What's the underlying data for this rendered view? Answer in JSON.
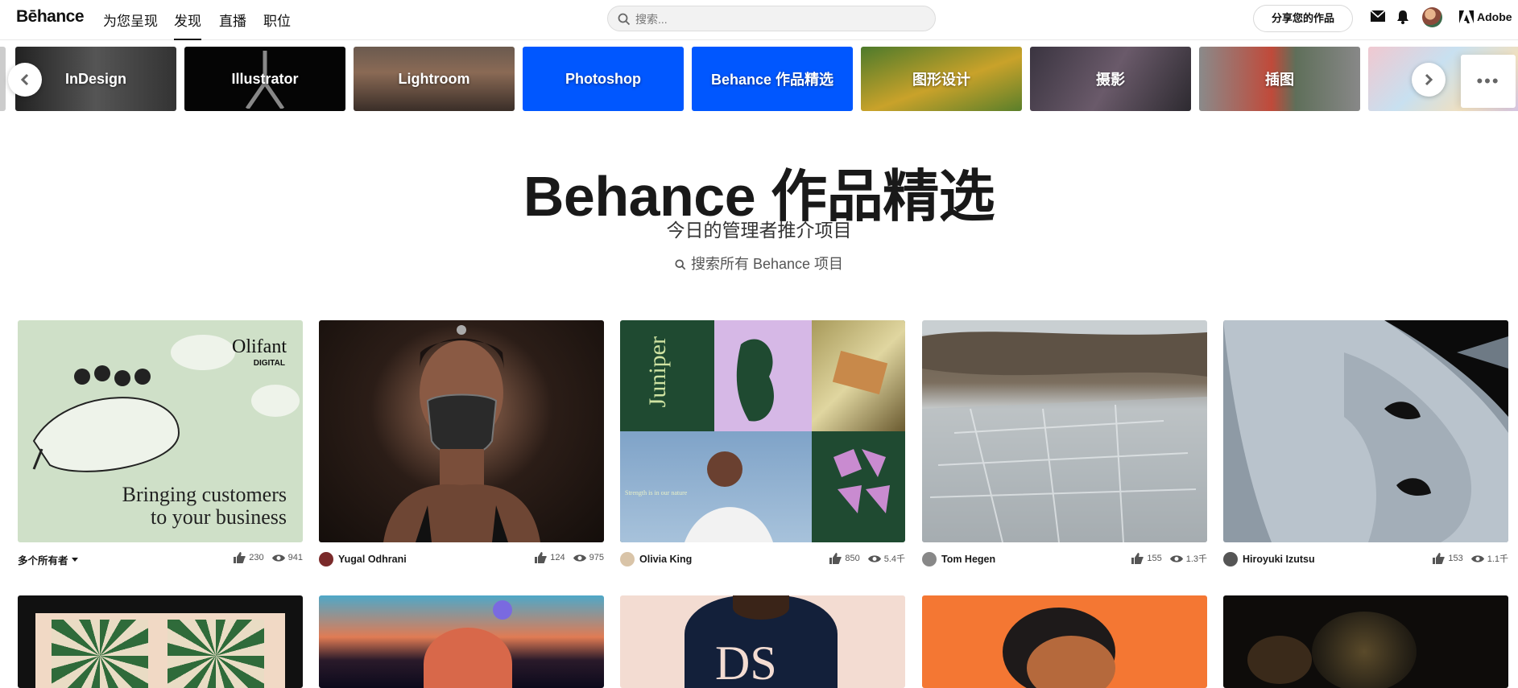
{
  "topnav": {
    "logo": "Bēhance",
    "links": [
      "为您呈现",
      "发现",
      "直播",
      "职位"
    ],
    "search_placeholder": "搜索...",
    "share_label": "分享您的作品",
    "adobe_label": "Adobe"
  },
  "categories": [
    "InDesign",
    "Illustrator",
    "Lightroom",
    "Photoshop",
    "Behance 作品精选",
    "图形设计",
    "摄影",
    "插图",
    ""
  ],
  "hero": {
    "title": "Behance 作品精选",
    "subtitle": "今日的管理者推介项目",
    "search_label": "搜索所有 Behance 项目"
  },
  "cards": [
    {
      "owner": "多个所有者",
      "likes": "230",
      "views": "941",
      "card_text_1": "Olifant",
      "card_text_2": "DIGITAL",
      "card_text_3": "Bringing customers",
      "card_text_4": "to your business"
    },
    {
      "owner": "Yugal Odhrani",
      "likes": "124",
      "views": "975"
    },
    {
      "owner": "Olivia King",
      "likes": "850",
      "views": "5.4千",
      "card_text_1": "Juniper",
      "card_text_2": "Strength is in our nature"
    },
    {
      "owner": "Tom Hegen",
      "likes": "155",
      "views": "1.3千"
    },
    {
      "owner": "Hiroyuki Izutsu",
      "likes": "153",
      "views": "1.1千"
    }
  ],
  "row2_texts": [
    "DS"
  ],
  "colors": {
    "accent": "#0057ff",
    "text": "#191919"
  }
}
